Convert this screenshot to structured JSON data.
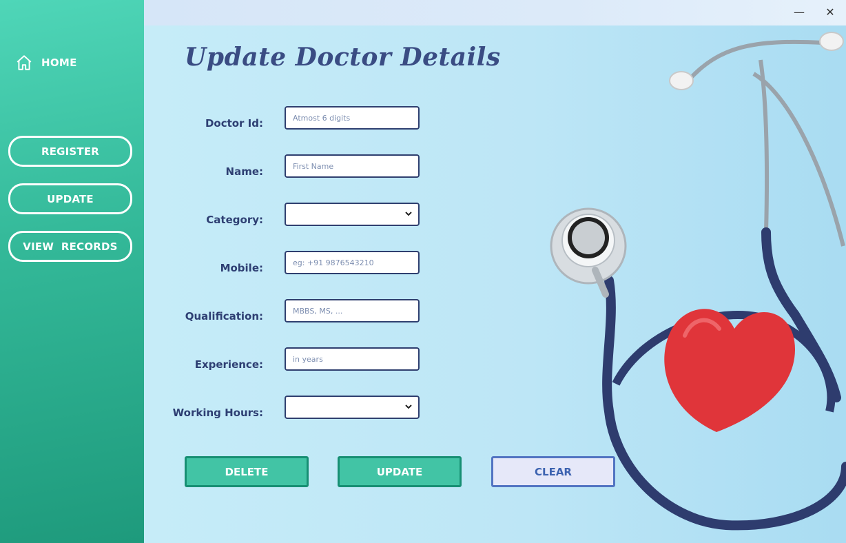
{
  "window": {
    "minimize_glyph": "—",
    "close_glyph": "✕"
  },
  "sidebar": {
    "home_label": "HOME",
    "home_icon": "home-icon",
    "buttons": [
      "REGISTER",
      "UPDATE",
      "VIEW  RECORDS"
    ]
  },
  "page": {
    "title": "Update Doctor Details"
  },
  "form": {
    "doctor_id": {
      "label": "Doctor Id:",
      "value": "",
      "placeholder": "Atmost 6 digits"
    },
    "name": {
      "label": "Name:",
      "value": "",
      "placeholder": "First Name"
    },
    "category": {
      "label": "Category:",
      "selected": ""
    },
    "mobile": {
      "label": "Mobile:",
      "value": "",
      "placeholder": "eg: +91 9876543210"
    },
    "qualification": {
      "label": "Qualification:",
      "value": "",
      "placeholder": "MBBS, MS, ..."
    },
    "experience": {
      "label": "Experience:",
      "value": "",
      "placeholder": "in years"
    },
    "working_hours": {
      "label": "Working Hours:",
      "selected": ""
    }
  },
  "actions": {
    "delete": "DELETE",
    "update": "UPDATE",
    "clear": "CLEAR"
  },
  "colors": {
    "sidebar_accent": "#33b898",
    "title": "#3a4c83",
    "action_button": "#42c4a5",
    "clear_button": "#e6e8f9",
    "heart": "#e0353a",
    "stethoscope_tube": "#2e3c6e"
  },
  "background_image": {
    "icon": "stethoscope-heart-illustration"
  }
}
